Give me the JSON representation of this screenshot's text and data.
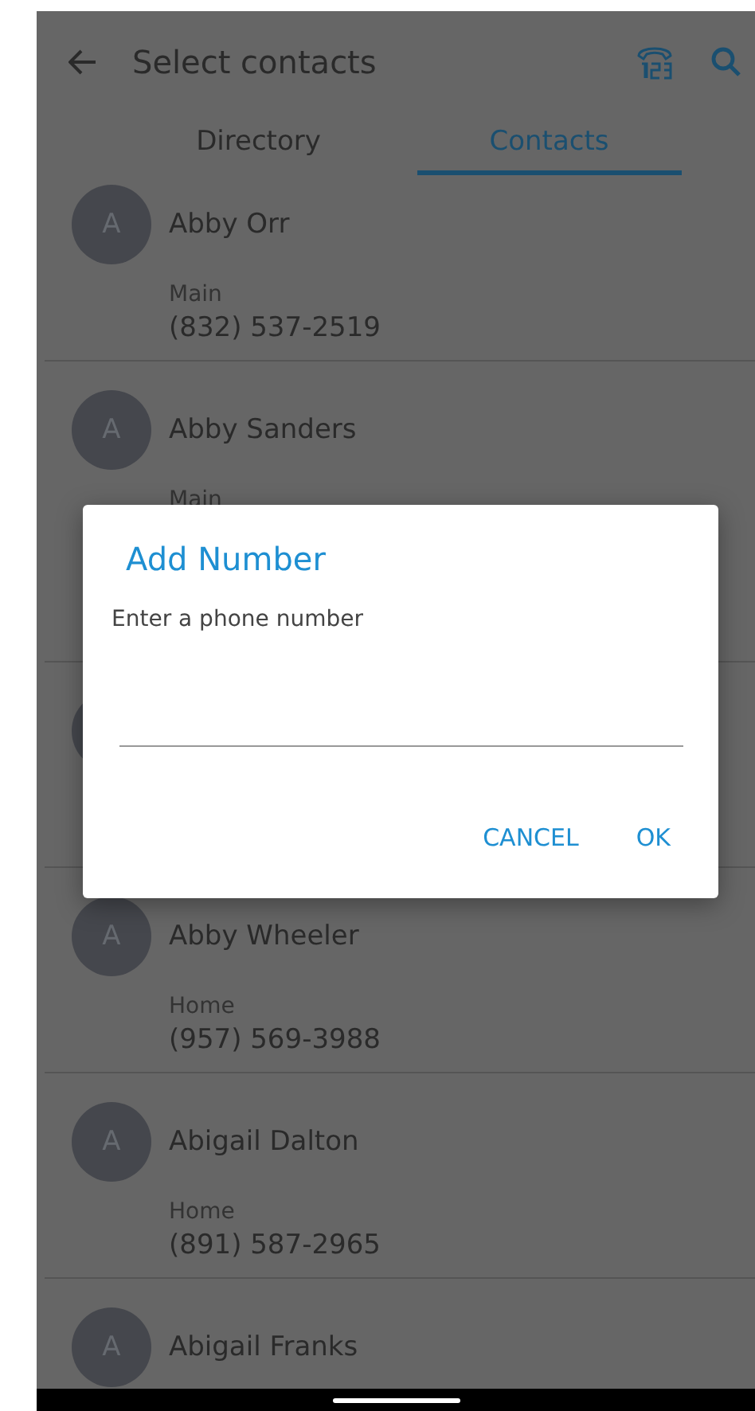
{
  "header": {
    "title": "Select contacts"
  },
  "tabs": [
    {
      "label": "Directory",
      "selected": false
    },
    {
      "label": "Contacts",
      "selected": true
    }
  ],
  "contacts": [
    {
      "initial": "A",
      "name": "Abby Orr",
      "phone_label": "Main",
      "phone": "(832) 537-2519"
    },
    {
      "kind": "tall",
      "initial": "A",
      "name": "Abby Sanders",
      "phone_label": "Main"
    },
    {
      "kind": "plain"
    },
    {
      "initial": "A",
      "name": "Abby Wheeler",
      "phone_label": "Home",
      "phone": "(957) 569-3988"
    },
    {
      "initial": "A",
      "name": "Abigail Dalton",
      "phone_label": "Home",
      "phone": "(891) 587-2965"
    },
    {
      "initial": "A",
      "name": "Abigail Franks"
    }
  ],
  "dialog": {
    "title": "Add Number",
    "prompt": "Enter a phone number",
    "buttons": [
      "CANCEL",
      "OK"
    ]
  }
}
